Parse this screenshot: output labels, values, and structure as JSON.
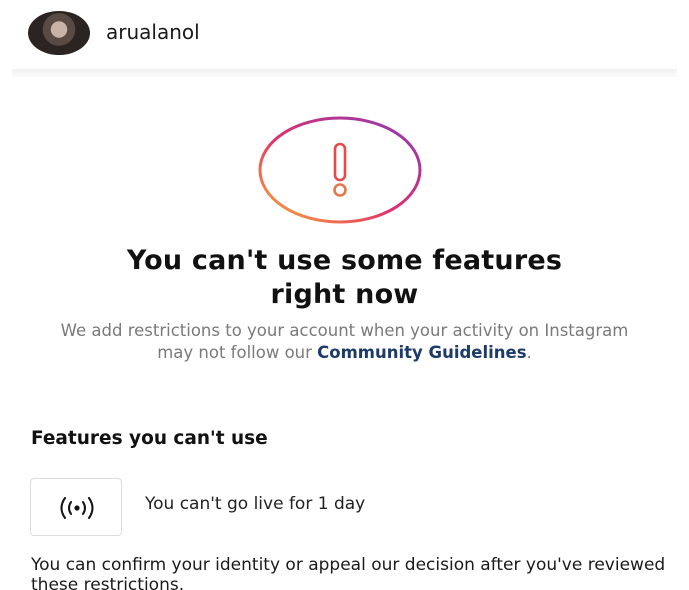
{
  "header": {
    "username": "arualanol"
  },
  "notice": {
    "title_line1": "You can't use some features",
    "title_line2": "right now",
    "description_prefix": "We add restrictions to your account when your activity on Instagram may not follow our ",
    "link_text": "Community Guidelines",
    "description_suffix": "."
  },
  "features_section": {
    "heading": "Features you can't use",
    "items": [
      {
        "icon": "live-broadcast-icon",
        "label": "You can't go live for 1 day"
      }
    ]
  },
  "footer": {
    "text": "You can confirm your identity or appeal our decision after you've reviewed these restrictions."
  },
  "colors": {
    "link": "#1c3b68",
    "muted_text": "#7a7a7a",
    "ring_gradient": [
      "#f58529",
      "#dd2a7b",
      "#8134af"
    ]
  }
}
